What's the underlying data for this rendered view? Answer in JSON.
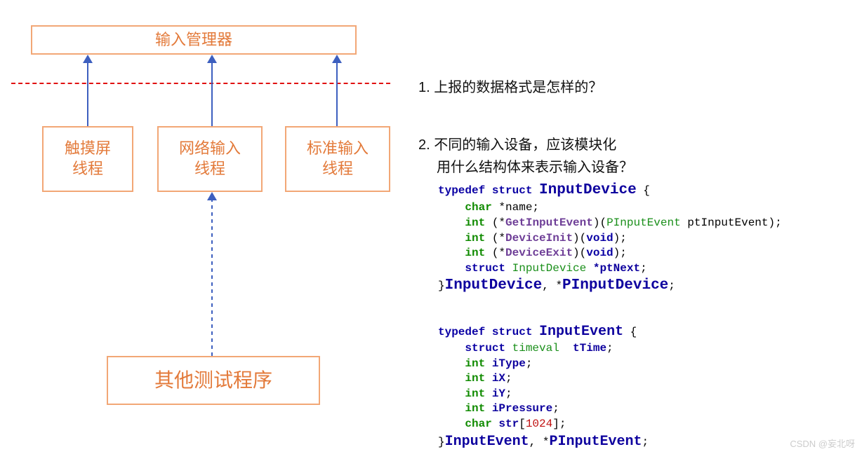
{
  "diagram": {
    "manager": "输入管理器",
    "threads": {
      "touch": "触摸屏\n线程",
      "net": "网络输入\n线程",
      "std": "标准输入\n线程"
    },
    "other": "其他测试程序"
  },
  "questions": {
    "q1": "1. 上报的数据格式是怎样的？",
    "q2a": "2. 不同的输入设备，应该模块化",
    "q2b": "用什么结构体来表示输入设备？"
  },
  "code1": {
    "l1_typedef": "typedef",
    "l1_struct": "struct",
    "l1_name": "InputDevice",
    "l1_brace": " {",
    "l2_char": "char",
    "l2_rest": " *name;",
    "l3_int": "int",
    "l3_open": " (*",
    "l3_fn": "GetInputEvent",
    "l3_mid": ")(",
    "l3_arg_t": "PInputEvent",
    "l3_arg_v": " ptInputEvent",
    "l3_close": ");",
    "l4_int": "int",
    "l4_open": " (*",
    "l4_fn": "DeviceInit",
    "l4_mid": ")(",
    "l4_void": "void",
    "l4_close": ");",
    "l5_int": "int",
    "l5_open": " (*",
    "l5_fn": "DeviceExit",
    "l5_mid": ")(",
    "l5_void": "void",
    "l5_close": ");",
    "l6_struct": "struct",
    "l6_type": " InputDevice ",
    "l6_mem": "*ptNext",
    "l6_semi": ";",
    "l7_brace": "}",
    "l7_n1": "InputDevice",
    "l7_comma": ", *",
    "l7_n2": "PInputDevice",
    "l7_semi": ";"
  },
  "code2": {
    "l1_typedef": "typedef",
    "l1_struct": "struct",
    "l1_name": "InputEvent",
    "l1_brace": " {",
    "l2_struct": "struct",
    "l2_tv": " timeval  ",
    "l2_mem": "tTime",
    "l2_semi": ";",
    "l3_int": "int",
    "l3_mem": " iType",
    "l3_semi": ";",
    "l4_int": "int",
    "l4_mem": " iX",
    "l4_semi": ";",
    "l5_int": "int",
    "l5_mem": " iY",
    "l5_semi": ";",
    "l6_int": "int",
    "l6_mem": " iPressure",
    "l6_semi": ";",
    "l7_char": "char",
    "l7_mem": " str",
    "l7_lb": "[",
    "l7_num": "1024",
    "l7_rb": "];",
    "l8_brace": "}",
    "l8_n1": "InputEvent",
    "l8_comma": ", *",
    "l8_n2": "PInputEvent",
    "l8_semi": ";"
  },
  "watermark": "CSDN @妄北呀"
}
